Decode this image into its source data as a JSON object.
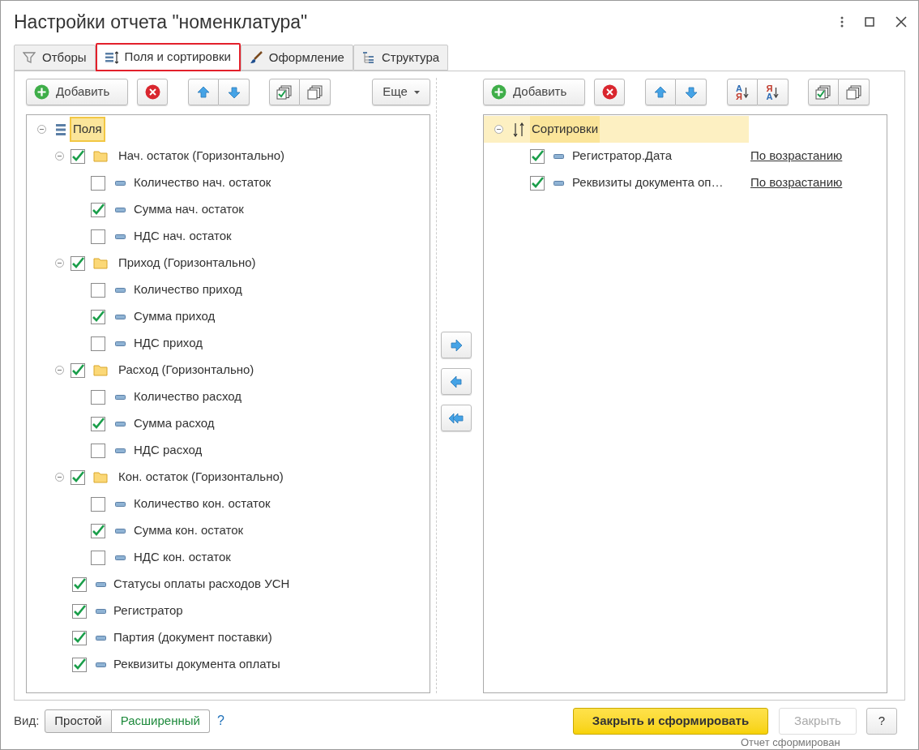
{
  "window": {
    "title": "Настройки отчета \"номенклатура\""
  },
  "tabs": [
    {
      "label": "Отборы",
      "kind": "filter",
      "selected": false
    },
    {
      "label": "Поля и сортировки",
      "kind": "fields",
      "selected": true
    },
    {
      "label": "Оформление",
      "kind": "design",
      "selected": false
    },
    {
      "label": "Структура",
      "kind": "structure",
      "selected": false
    }
  ],
  "fields_toolbar": {
    "add_label": "Добавить",
    "more_label": "Еще"
  },
  "fields_tree": {
    "label": "Поля",
    "selected": true,
    "expanded": true,
    "children": [
      {
        "label": "Нач. остаток (Горизонтально)",
        "kind": "group",
        "checked": true,
        "expanded": true,
        "children": [
          {
            "label": "Количество нач. остаток",
            "checked": false
          },
          {
            "label": "Сумма нач. остаток",
            "checked": true
          },
          {
            "label": "НДС нач. остаток",
            "checked": false
          }
        ]
      },
      {
        "label": "Приход (Горизонтально)",
        "kind": "group",
        "checked": true,
        "expanded": true,
        "children": [
          {
            "label": "Количество приход",
            "checked": false
          },
          {
            "label": "Сумма приход",
            "checked": true
          },
          {
            "label": "НДС приход",
            "checked": false
          }
        ]
      },
      {
        "label": "Расход (Горизонтально)",
        "kind": "group",
        "checked": true,
        "expanded": true,
        "children": [
          {
            "label": "Количество расход",
            "checked": false
          },
          {
            "label": "Сумма расход",
            "checked": true
          },
          {
            "label": "НДС расход",
            "checked": false
          }
        ]
      },
      {
        "label": "Кон. остаток (Горизонтально)",
        "kind": "group",
        "checked": true,
        "expanded": true,
        "children": [
          {
            "label": "Количество кон. остаток",
            "checked": false
          },
          {
            "label": "Сумма кон. остаток",
            "checked": true
          },
          {
            "label": "НДС кон. остаток",
            "checked": false
          }
        ]
      },
      {
        "label": "Статусы оплаты расходов УСН",
        "kind": "field",
        "checked": true
      },
      {
        "label": "Регистратор",
        "kind": "field",
        "checked": true
      },
      {
        "label": "Партия (документ поставки)",
        "kind": "field",
        "checked": true
      },
      {
        "label": "Реквизиты документа оплаты",
        "kind": "field",
        "checked": true
      }
    ]
  },
  "sort_toolbar": {
    "add_label": "Добавить",
    "sort_buttons": [
      {
        "letters": [
          {
            "text": "А",
            "color": "#2f6db5"
          },
          {
            "text": "Я",
            "color": "#c0392b"
          }
        ]
      },
      {
        "letters": [
          {
            "text": "Я",
            "color": "#c0392b"
          },
          {
            "text": "А",
            "color": "#2f6db5"
          }
        ]
      }
    ]
  },
  "sort_tree": {
    "label": "Сортировки",
    "selected": true,
    "expanded": true,
    "children": [
      {
        "label": "Регистратор.Дата",
        "checked": true,
        "direction": "По возрастанию"
      },
      {
        "label": "Реквизиты документа оп…",
        "checked": true,
        "direction": "По возрастанию"
      }
    ]
  },
  "footer": {
    "view_label": "Вид:",
    "modes": [
      {
        "label": "Простой",
        "selected": false
      },
      {
        "label": "Расширенный",
        "selected": true
      }
    ],
    "help_link": "?",
    "primary_button": "Закрыть и сформировать",
    "close_button": {
      "label": "Закрыть",
      "disabled": true
    },
    "help_button": "?"
  },
  "notification": "Отчет сформирован"
}
